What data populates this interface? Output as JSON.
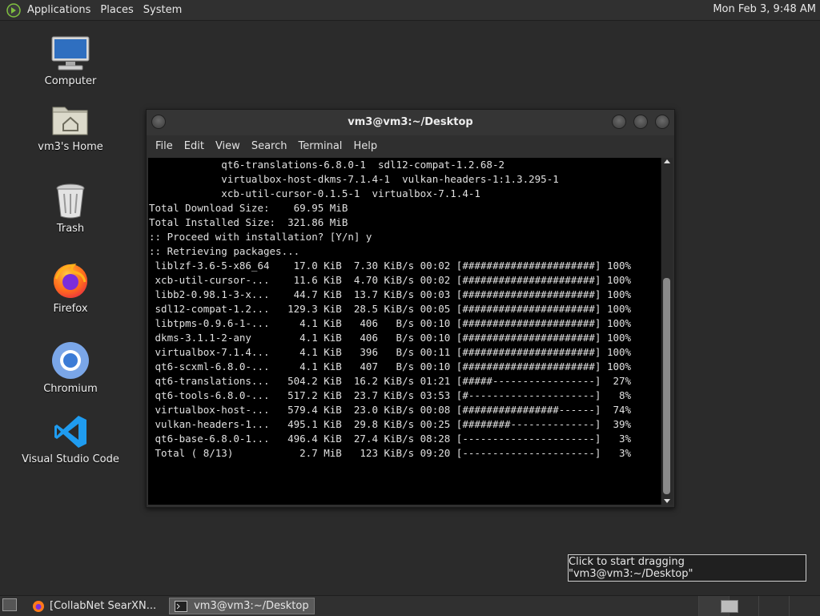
{
  "top_panel": {
    "menus": [
      "Applications",
      "Places",
      "System"
    ],
    "clock": "Mon Feb  3,  9:48 AM"
  },
  "desktop": {
    "icons": [
      {
        "label": "Computer",
        "icon": "computer-icon"
      },
      {
        "label": "vm3's Home",
        "icon": "home-folder-icon"
      },
      {
        "label": "Trash",
        "icon": "trash-icon"
      },
      {
        "label": "Firefox",
        "icon": "firefox-icon"
      },
      {
        "label": "Chromium",
        "icon": "chromium-icon"
      },
      {
        "label": "Visual Studio Code",
        "icon": "vscode-icon"
      }
    ]
  },
  "terminal": {
    "title": "vm3@vm3:~/Desktop",
    "menus": [
      "File",
      "Edit",
      "View",
      "Search",
      "Terminal",
      "Help"
    ],
    "lines": [
      "            qt6-translations-6.8.0-1  sdl12-compat-1.2.68-2",
      "            virtualbox-host-dkms-7.1.4-1  vulkan-headers-1:1.3.295-1",
      "            xcb-util-cursor-0.1.5-1  virtualbox-7.1.4-1",
      "",
      "Total Download Size:    69.95 MiB",
      "Total Installed Size:  321.86 MiB",
      "",
      ":: Proceed with installation? [Y/n] y",
      ":: Retrieving packages...",
      " liblzf-3.6-5-x86_64    17.0 KiB  7.30 KiB/s 00:02 [######################] 100%",
      " xcb-util-cursor-...    11.6 KiB  4.70 KiB/s 00:02 [######################] 100%",
      " libb2-0.98.1-3-x...    44.7 KiB  13.7 KiB/s 00:03 [######################] 100%",
      " sdl12-compat-1.2...   129.3 KiB  28.5 KiB/s 00:05 [######################] 100%",
      " libtpms-0.9.6-1-...     4.1 KiB   406   B/s 00:10 [######################] 100%",
      " dkms-3.1.1-2-any        4.1 KiB   406   B/s 00:10 [######################] 100%",
      " virtualbox-7.1.4...     4.1 KiB   396   B/s 00:11 [######################] 100%",
      " qt6-scxml-6.8.0-...     4.1 KiB   407   B/s 00:10 [######################] 100%",
      " qt6-translations...   504.2 KiB  16.2 KiB/s 01:21 [#####-----------------]  27%",
      " qt6-tools-6.8.0-...   517.2 KiB  23.7 KiB/s 03:53 [#---------------------]   8%",
      " virtualbox-host-...   579.4 KiB  23.0 KiB/s 00:08 [################------]  74%",
      " vulkan-headers-1...   495.1 KiB  29.8 KiB/s 00:25 [########--------------]  39%",
      " qt6-base-6.8.0-1...   496.4 KiB  27.4 KiB/s 08:28 [----------------------]   3%",
      " Total ( 8/13)           2.7 MiB   123 KiB/s 09:20 [----------------------]   3%"
    ]
  },
  "tooltip": "Click to start dragging \"vm3@vm3:~/Desktop\"",
  "taskbar": {
    "tasks": [
      "[CollabNet SearXN...",
      "vm3@vm3:~/Desktop"
    ]
  }
}
